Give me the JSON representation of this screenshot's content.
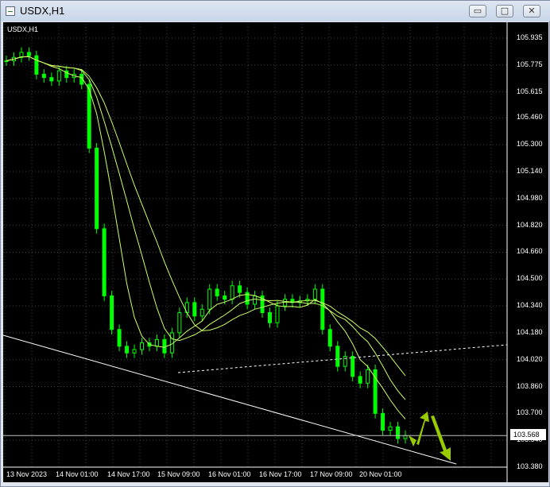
{
  "window": {
    "title": "USDX,H1",
    "min_label": "▭",
    "max_label": "□",
    "close_label": "✕"
  },
  "chart_label": "USDX,H1",
  "current_price": "103.568",
  "colors": {
    "bg": "#000000",
    "candles": "#00ff00",
    "grid": "#404040",
    "ma": "#ccff66",
    "arrows": "#99cc00",
    "trend": "#ffffff"
  },
  "chart_data": {
    "type": "line",
    "title": "USDX,H1",
    "y_ticks": [
      "105.935",
      "105.775",
      "105.615",
      "105.460",
      "105.300",
      "105.140",
      "104.980",
      "104.820",
      "104.660",
      "104.500",
      "104.340",
      "104.180",
      "104.020",
      "103.860",
      "103.700",
      "103.540",
      "103.380"
    ],
    "x_ticks": [
      "13 Nov 2023",
      "14 Nov 01:00",
      "14 Nov 17:00",
      "15 Nov 09:00",
      "16 Nov 01:00",
      "16 Nov 17:00",
      "17 Nov 09:00",
      "20 Nov 01:00"
    ],
    "ylim": [
      103.38,
      106.02
    ],
    "close_series": [
      105.8,
      105.82,
      105.85,
      105.83,
      105.72,
      105.7,
      105.68,
      105.74,
      105.7,
      105.72,
      105.66,
      105.28,
      104.8,
      104.4,
      104.2,
      104.1,
      104.06,
      104.08,
      104.12,
      104.1,
      104.14,
      104.06,
      104.18,
      104.3,
      104.36,
      104.28,
      104.32,
      104.44,
      104.4,
      104.38,
      104.46,
      104.42,
      104.35,
      104.4,
      104.3,
      104.24,
      104.34,
      104.38,
      104.36,
      104.37,
      104.38,
      104.44,
      104.2,
      104.1,
      103.98,
      104.04,
      103.92,
      103.88,
      103.96,
      103.7,
      103.6,
      103.62,
      103.55,
      103.568
    ],
    "grid": true
  }
}
